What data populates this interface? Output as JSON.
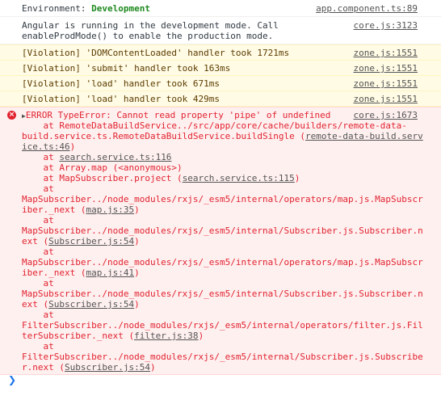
{
  "messages": {
    "env": {
      "label": "Environment: ",
      "value": "Development",
      "source": "app.component.ts:89"
    },
    "angular_dev": {
      "line1": "Angular is running in the development mode. Call",
      "line2": "enableProdMode() to enable the production mode.",
      "source": "core.js:3123"
    },
    "violations": [
      {
        "text": "[Violation] 'DOMContentLoaded' handler took 1721ms",
        "source": "zone.js:1551"
      },
      {
        "text": "[Violation] 'submit' handler took 163ms",
        "source": "zone.js:1551"
      },
      {
        "text": "[Violation] 'load' handler took 671ms",
        "source": "zone.js:1551"
      },
      {
        "text": "[Violation] 'load' handler took 429ms",
        "source": "zone.js:1551"
      }
    ],
    "error": {
      "icon": "error-icon",
      "headline": "ERROR TypeError: Cannot read property 'pipe' of undefined",
      "source": "core.js:1673",
      "l1": "    at RemoteDataBuildService../src/app/core/cache/builders/remote-data-",
      "l2a": "build.service.ts.RemoteDataBuildService.buildSingle (",
      "l2link": "remote-data-build.serv",
      "l3link": "ice.ts:46",
      "l3b": ")",
      "l4a": "    at ",
      "l4link": "search.service.ts:116",
      "l5": "    at Array.map (<anonymous>)",
      "l6a": "    at MapSubscriber.project (",
      "l6link": "search.service.ts:115",
      "l6b": ")",
      "at": "    at",
      "l8": "MapSubscriber../node_modules/rxjs/_esm5/internal/operators/map.js.MapSubscr",
      "l9a": "iber._next (",
      "l9link": "map.js:35",
      "l9b": ")",
      "l11": "MapSubscriber../node_modules/rxjs/_esm5/internal/Subscriber.js.Subscriber.n",
      "l12a": "ext (",
      "l12link": "Subscriber.js:54",
      "l12b": ")",
      "l14": "MapSubscriber../node_modules/rxjs/_esm5/internal/operators/map.js.MapSubscr",
      "l15a": "iber._next (",
      "l15link": "map.js:41",
      "l15b": ")",
      "l17": "MapSubscriber../node_modules/rxjs/_esm5/internal/Subscriber.js.Subscriber.n",
      "l18a": "ext (",
      "l18link": "Subscriber.js:54",
      "l18b": ")",
      "l20": "FilterSubscriber../node_modules/rxjs/_esm5/internal/operators/filter.js.Fil",
      "l21a": "terSubscriber._next (",
      "l21link": "filter.js:38",
      "l21b": ")",
      "l23": "FilterSubscriber../node_modules/rxjs/_esm5/internal/Subscriber.js.Subscribe",
      "l24a": "r.next (",
      "l24link": "Subscriber.js:54",
      "l24b": ")"
    }
  },
  "prompt": {
    "symbol": "❯"
  },
  "colors": {
    "error": "#e0232f",
    "warning_bg": "#fffbe5",
    "error_bg": "#fff0f0",
    "prompt": "#1a73e8"
  }
}
